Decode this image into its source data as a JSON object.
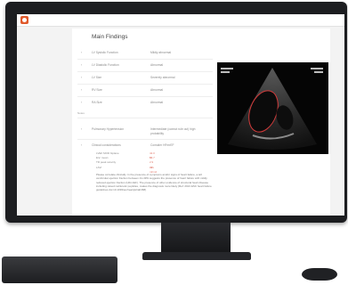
{
  "report": {
    "title": "Main Findings",
    "findings": [
      {
        "label": "LV Systolic Function",
        "value": "Mildly abnormal"
      },
      {
        "label": "LV Diastolic Function",
        "value": "Abnormal"
      },
      {
        "label": "LV Size",
        "value": "Severely abnormal"
      },
      {
        "label": "RV Size",
        "value": "Abnormal"
      },
      {
        "label": "RA Size",
        "value": "Abnormal"
      }
    ],
    "notes_label": "Notes",
    "findings2": [
      {
        "label": "Pulmonary Hypertension",
        "value": "Intermediate (cannot rule out) high probability"
      },
      {
        "label": "Clinical considerations",
        "value": "Consider HFmrEF"
      }
    ],
    "measurements": [
      {
        "name": "LVEF MOD biplane",
        "value": "42.0 %"
      },
      {
        "name": "E/e' mean",
        "value": "16.7"
      },
      {
        "name": "TR peak velocity",
        "value": "2.9 m/s"
      },
      {
        "name": "LAVi",
        "value": "43 ml/m2"
      }
    ],
    "paragraph": "Please correlate clinically. In the presence of symptoms and/or signs of heart failure, a left ventricular ejection fraction between 41-49% suggests the presence of heart failure with mildly reduced ejection fraction (HFmrEF). The presence of other evidence of structural heart disease including raised natriuretic peptides, makes the diagnosis more likely (Ref: 2021 ESC heart failure guidelines doi:10.1093/eurheartj/ehab368)"
  },
  "colors": {
    "accent": "#e0796b",
    "logo": "#e05a2c"
  }
}
